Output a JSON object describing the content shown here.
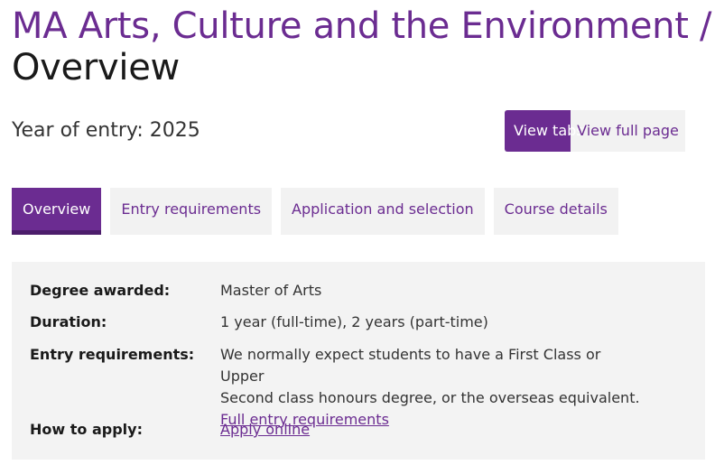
{
  "header": {
    "course_title": "MA Arts, Culture and the Environment",
    "separator": "/",
    "section_title": "Overview"
  },
  "entry": {
    "year_label": "Year of entry: 2025"
  },
  "view_toggle": {
    "tabs_label": "View tabs",
    "full_page_label": "View full page",
    "selected": "View tabs"
  },
  "tabs": [
    {
      "label": "Overview",
      "active": true
    },
    {
      "label": "Entry requirements",
      "active": false
    },
    {
      "label": "Application and selection",
      "active": false
    },
    {
      "label": "Course details",
      "active": false
    }
  ],
  "summary": {
    "degree": {
      "label": "Degree awarded:",
      "value": "Master of Arts"
    },
    "duration": {
      "label": "Duration:",
      "value": "1 year (full-time), 2 years (part-time)"
    },
    "entry_requirements": {
      "label": "Entry requirements:",
      "line1": "We normally expect students to have a First Class or Upper",
      "line2": "Second class honours degree, or the overseas equivalent.",
      "link": "Full entry requirements"
    },
    "how_to_apply": {
      "label": "How to apply:",
      "link": "Apply online"
    }
  },
  "colors": {
    "brand_purple": "#6b2c91",
    "tab_background": "#f2f2f2",
    "panel_background": "#f3f3f3"
  }
}
